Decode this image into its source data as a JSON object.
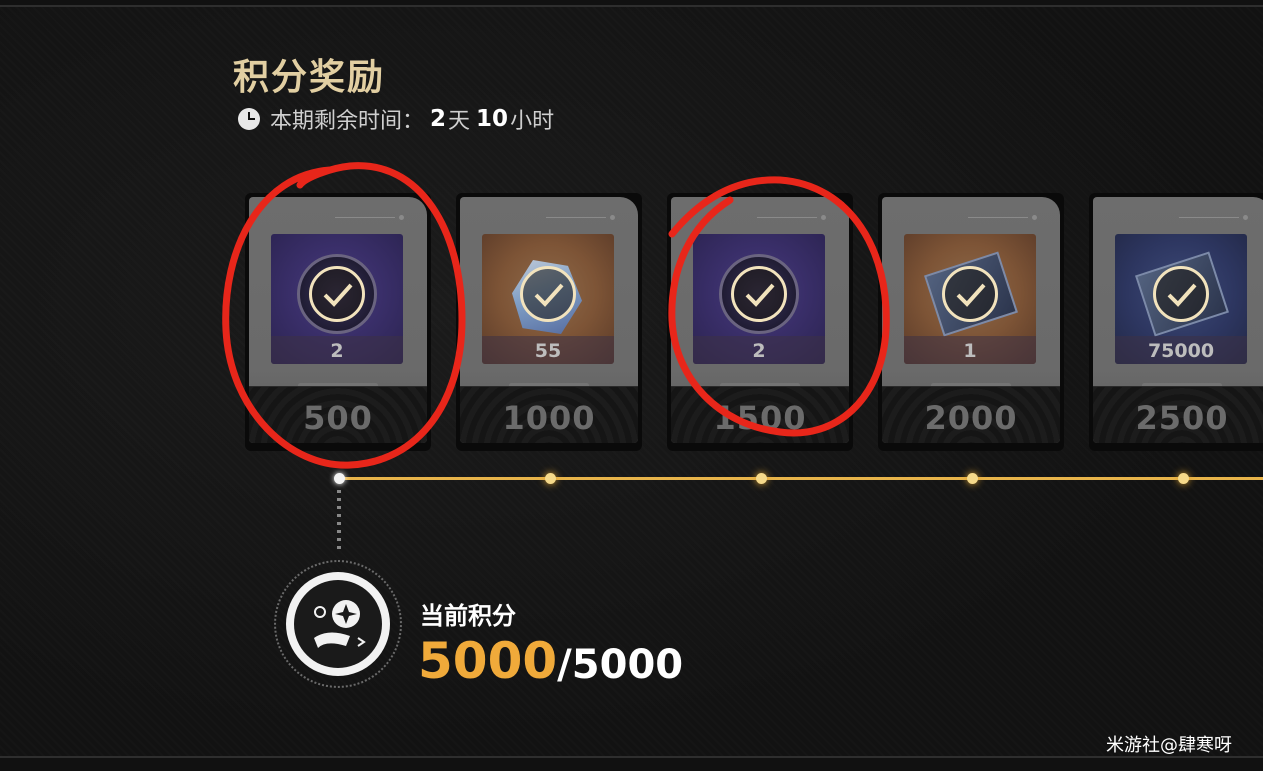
{
  "title": "积分奖励",
  "timer": {
    "label": "本期剩余时间：",
    "days": "2",
    "days_unit": "天",
    "hours": "10",
    "hours_unit": "小时"
  },
  "rewards": [
    {
      "qty": "2",
      "points": "500",
      "claimed": true,
      "art": "purple-emblem"
    },
    {
      "qty": "55",
      "points": "1000",
      "claimed": true,
      "art": "orange-crystal"
    },
    {
      "qty": "2",
      "points": "1500",
      "claimed": true,
      "art": "purple-emblem"
    },
    {
      "qty": "1",
      "points": "2000",
      "claimed": true,
      "art": "orange-ticket"
    },
    {
      "qty": "75000",
      "points": "2500",
      "claimed": true,
      "art": "blue-ticket"
    }
  ],
  "current": {
    "label": "当前积分",
    "value": "5000",
    "separator": "/",
    "max": "5000"
  },
  "colors": {
    "accent": "#f0aa3a",
    "title": "#e2cfa2",
    "track": "#e8b44a",
    "annotation": "#e8261a"
  },
  "watermark": "米游社@肆寒呀"
}
